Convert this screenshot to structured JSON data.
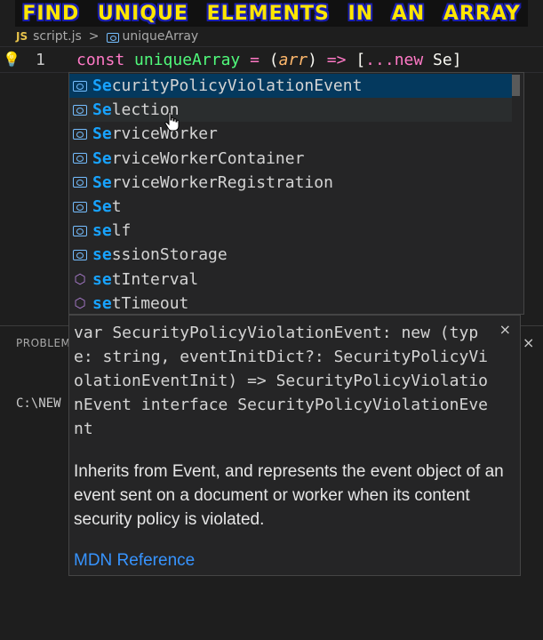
{
  "banner": {
    "title": "FIND UNIQUE ELEMENTS IN AN ARRAY"
  },
  "breadcrumb": {
    "file_icon": "JS",
    "file": "script.js",
    "separator": ">",
    "symbol": "uniqueArray"
  },
  "editor": {
    "line_number": "1",
    "code_tokens": {
      "kw_const": "const",
      "fn_name": "uniqueArray",
      "eq": " = ",
      "paren_open": "(",
      "param": "arr",
      "paren_close": ")",
      "arrow": " => ",
      "bracket": "[",
      "spread": "...",
      "kw_new": "new",
      "typed": " Se",
      "bracket_close": "]"
    }
  },
  "suggestions": [
    {
      "prefix": "Se",
      "rest": "curityPolicyViolationEvent",
      "icon": "variable-icon"
    },
    {
      "prefix": "Se",
      "rest": "lection",
      "icon": "variable-icon"
    },
    {
      "prefix": "Se",
      "rest": "rviceWorker",
      "icon": "variable-icon"
    },
    {
      "prefix": "Se",
      "rest": "rviceWorkerContainer",
      "icon": "variable-icon"
    },
    {
      "prefix": "Se",
      "rest": "rviceWorkerRegistration",
      "icon": "variable-icon"
    },
    {
      "prefix": "Se",
      "rest": "t",
      "icon": "variable-icon"
    },
    {
      "prefix": "se",
      "rest": "lf",
      "icon": "variable-icon"
    },
    {
      "prefix": "se",
      "rest": "ssionStorage",
      "icon": "variable-icon"
    },
    {
      "prefix": "se",
      "rest": "tInterval",
      "icon": "method-icon"
    },
    {
      "prefix": "se",
      "rest": "tTimeout",
      "icon": "method-icon"
    }
  ],
  "doc": {
    "signature": "var SecurityPolicyViolationEvent: new (type: string, eventInitDict?: SecurityPolicyViolationEventInit) => SecurityPolicyViolationEvent interface SecurityPolicyViolationEvent",
    "description": "Inherits from Event, and represents the event object of an event sent on a document or worker when its content security policy is violated.",
    "link": "MDN Reference",
    "close": "×"
  },
  "panel": {
    "problems_label": "PROBLEMS",
    "close": "×",
    "terminal_text": "C:\\NEW"
  },
  "colors": {
    "accent": "#18a3ff",
    "banner_text": "#ffe600",
    "banner_outline": "#1a1fb0",
    "link": "#3794ff"
  }
}
